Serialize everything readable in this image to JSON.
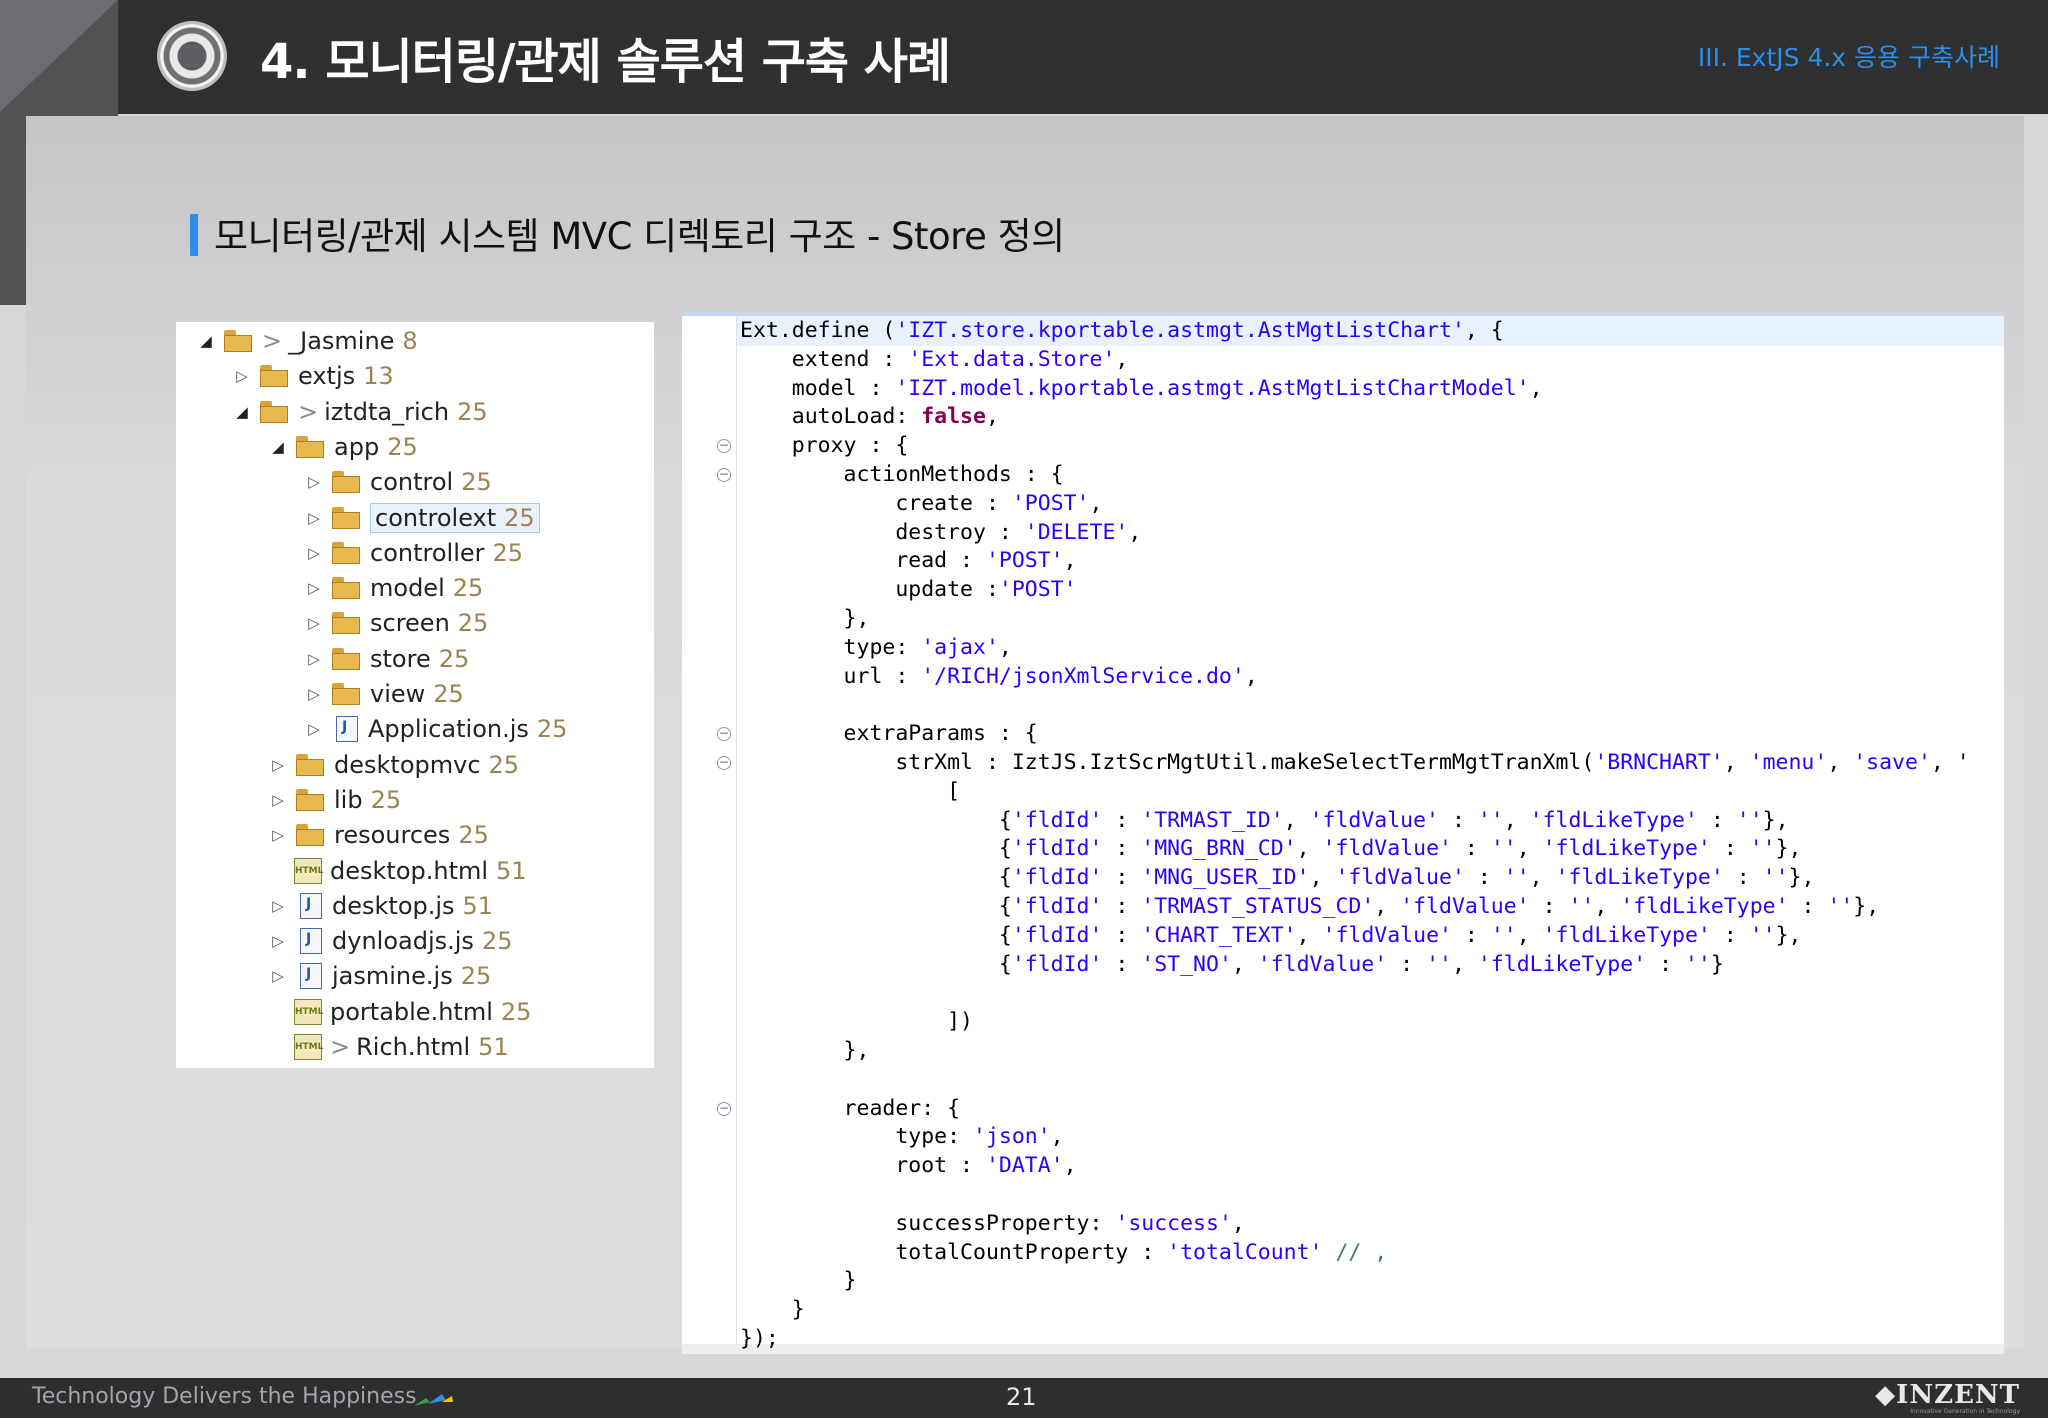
{
  "header": {
    "title": "4. 모니터링/관제 솔루션 구축 사례",
    "section": "III. ExtJS 4.x 응용 구축사례"
  },
  "subtitle": "모니터링/관제 시스템  MVC  디렉토리 구조  - Store 정의",
  "tree": [
    {
      "arrow": "◢",
      "icon": "folder",
      "prefix": ">",
      "name": "_Jasmine",
      "count": "8"
    },
    {
      "arrow": "▷",
      "icon": "folder",
      "prefix": "",
      "name": "extjs",
      "count": "13"
    },
    {
      "arrow": "◢",
      "icon": "folder",
      "prefix": ">",
      "name": "iztdta_rich",
      "count": "25"
    },
    {
      "arrow": "◢",
      "icon": "folder",
      "prefix": "",
      "name": "app",
      "count": "25"
    },
    {
      "arrow": "▷",
      "icon": "folder",
      "prefix": "",
      "name": "control",
      "count": "25"
    },
    {
      "arrow": "▷",
      "icon": "folder",
      "prefix": "",
      "name": "controlext",
      "count": "25"
    },
    {
      "arrow": "▷",
      "icon": "folder",
      "prefix": "",
      "name": "controller",
      "count": "25"
    },
    {
      "arrow": "▷",
      "icon": "folder",
      "prefix": "",
      "name": "model",
      "count": "25"
    },
    {
      "arrow": "▷",
      "icon": "folder",
      "prefix": "",
      "name": "screen",
      "count": "25"
    },
    {
      "arrow": "▷",
      "icon": "folder",
      "prefix": "",
      "name": "store",
      "count": "25"
    },
    {
      "arrow": "▷",
      "icon": "folder",
      "prefix": "",
      "name": "view",
      "count": "25"
    },
    {
      "arrow": "▷",
      "icon": "js",
      "prefix": "",
      "name": "Application.js",
      "count": "25"
    },
    {
      "arrow": "▷",
      "icon": "folder",
      "prefix": "",
      "name": "desktopmvc",
      "count": "25"
    },
    {
      "arrow": "▷",
      "icon": "folder",
      "prefix": "",
      "name": "lib",
      "count": "25"
    },
    {
      "arrow": "▷",
      "icon": "folder",
      "prefix": "",
      "name": "resources",
      "count": "25"
    },
    {
      "arrow": "",
      "icon": "html",
      "prefix": "",
      "name": "desktop.html",
      "count": "51"
    },
    {
      "arrow": "▷",
      "icon": "js",
      "prefix": "",
      "name": "desktop.js",
      "count": "51"
    },
    {
      "arrow": "▷",
      "icon": "js",
      "prefix": "",
      "name": "dynloadjs.js",
      "count": "25"
    },
    {
      "arrow": "▷",
      "icon": "js",
      "prefix": "",
      "name": "jasmine.js",
      "count": "25"
    },
    {
      "arrow": "",
      "icon": "html",
      "prefix": "",
      "name": "portable.html",
      "count": "25"
    },
    {
      "arrow": "",
      "icon": "html",
      "prefix": ">",
      "name": "Rich.html",
      "count": "51"
    }
  ],
  "code": [
    "Ext.define ('IZT.store.kportable.astmgt.AstMgtListChart', {",
    "    extend : 'Ext.data.Store',",
    "    model : 'IZT.model.kportable.astmgt.AstMgtListChartModel',",
    "    autoLoad: false,",
    "    proxy : {",
    "        actionMethods : {",
    "            create : 'POST',",
    "            destroy : 'DELETE',",
    "            read : 'POST',",
    "            update :'POST'",
    "        },",
    "        type: 'ajax',",
    "        url : '/RICH/jsonXmlService.do',",
    "",
    "        extraParams : {",
    "            strXml : IztJS.IztScrMgtUtil.makeSelectTermMgtTranXml('BRNCHART', 'menu', 'save', '",
    "                [",
    "                    {'fldId' : 'TRMAST_ID', 'fldValue' : '', 'fldLikeType' : ''},",
    "                    {'fldId' : 'MNG_BRN_CD', 'fldValue' : '', 'fldLikeType' : ''},",
    "                    {'fldId' : 'MNG_USER_ID', 'fldValue' : '', 'fldLikeType' : ''},",
    "                    {'fldId' : 'TRMAST_STATUS_CD', 'fldValue' : '', 'fldLikeType' : ''},",
    "                    {'fldId' : 'CHART_TEXT', 'fldValue' : '', 'fldLikeType' : ''},",
    "                    {'fldId' : 'ST_NO', 'fldValue' : '', 'fldLikeType' : ''}",
    "",
    "                ])",
    "        },",
    "",
    "        reader: {",
    "            type: 'json',",
    "            root : 'DATA',",
    "",
    "            successProperty: 'success',",
    "            totalCountProperty : 'totalCount' // ,",
    "        }",
    "    }",
    "});"
  ],
  "footer": {
    "tagline": "Technology Delivers the Happiness",
    "page": "21",
    "brand": "INZENT",
    "brand_sub": "Innovative Generation in Technology"
  },
  "colors": {
    "accent": "#2f8ee8",
    "header_bg": "#2e3032",
    "ribbon": "#f5c400",
    "string": "#2a00ff",
    "keyword": "#7f0055"
  },
  "icons": [
    "gear-icon",
    "yellow-ribbon-icon",
    "folder-icon",
    "js-file-icon",
    "html-file-icon",
    "fold-icon",
    "brand-logo-icon"
  ]
}
